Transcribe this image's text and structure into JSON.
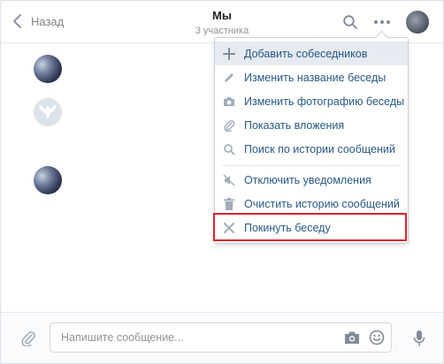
{
  "header": {
    "back_label": "Назад",
    "title": "Мы",
    "subtitle": "3 участника"
  },
  "menu": {
    "items": [
      {
        "label": "Добавить собеседников",
        "icon": "plus-icon"
      },
      {
        "label": "Изменить название беседы",
        "icon": "pencil-icon"
      },
      {
        "label": "Изменить фотографию беседы",
        "icon": "camera-icon"
      },
      {
        "label": "Показать вложения",
        "icon": "paperclip-icon"
      },
      {
        "label": "Поиск по истории сообщений",
        "icon": "search-icon"
      },
      {
        "label": "Отключить уведомления",
        "icon": "mute-icon"
      },
      {
        "label": "Очистить историю сообщений",
        "icon": "trash-icon"
      },
      {
        "label": "Покинуть беседу",
        "icon": "close-icon"
      }
    ]
  },
  "composer": {
    "placeholder": "Напишите сообщение..."
  },
  "colors": {
    "link": "#2a5885",
    "icon": "#828a99",
    "highlight": "#e0222c",
    "active_bg": "#e5ebf1"
  }
}
